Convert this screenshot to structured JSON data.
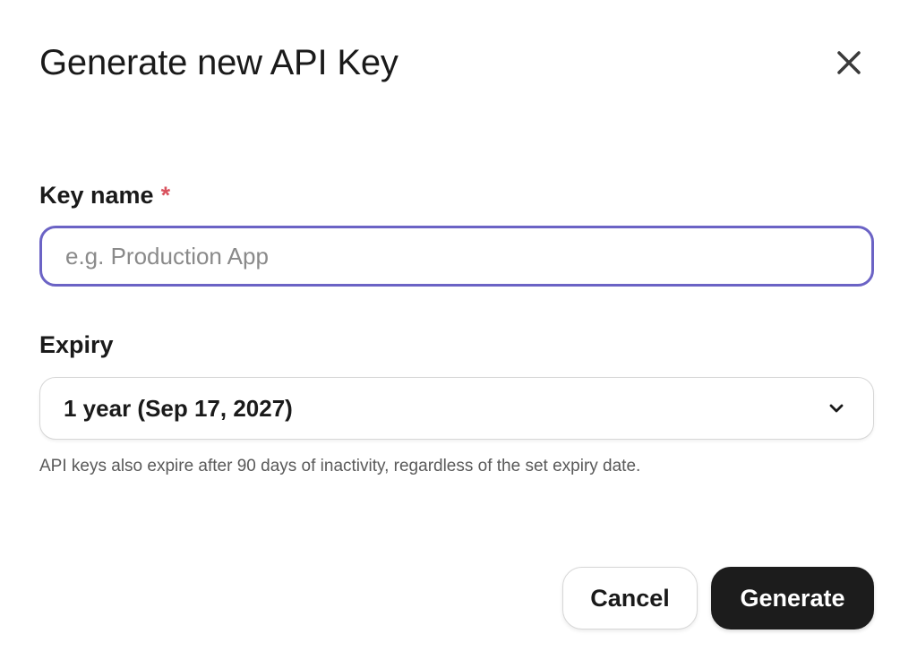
{
  "dialog": {
    "title": "Generate new API Key",
    "close_icon": "close-icon"
  },
  "key_name": {
    "label": "Key name",
    "required_marker": "*",
    "value": "",
    "placeholder": "e.g. Production App"
  },
  "expiry": {
    "label": "Expiry",
    "selected": "1 year (Sep 17, 2027)",
    "icon": "chevron-down-icon",
    "hint": "API keys also expire after 90 days of inactivity, regardless of the set expiry date."
  },
  "actions": {
    "cancel_label": "Cancel",
    "generate_label": "Generate"
  },
  "colors": {
    "focus_border": "#6b63c5",
    "required": "#d9525e",
    "primary_button": "#1c1c1c"
  }
}
